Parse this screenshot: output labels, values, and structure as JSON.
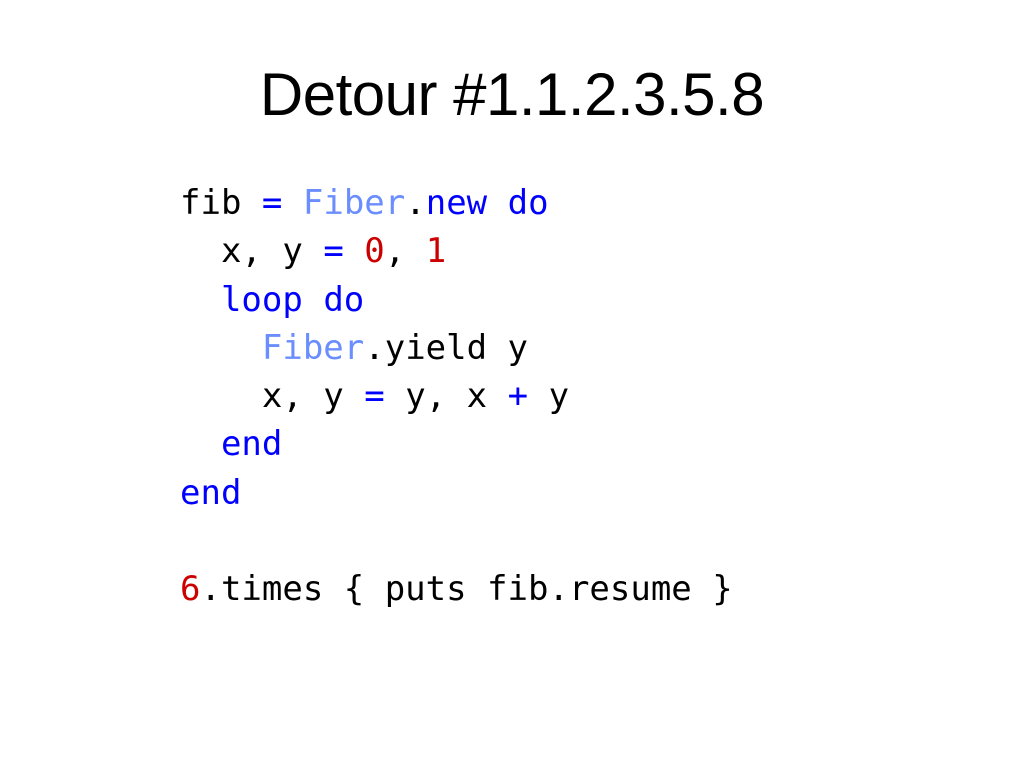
{
  "title": "Detour #1.1.2.3.5.8",
  "code": {
    "line1": {
      "fib": "fib",
      "sp1": " ",
      "eq": "=",
      "sp2": " ",
      "Fiber": "Fiber",
      "dot": ".",
      "new": "new",
      "sp3": " ",
      "do": "do"
    },
    "line2": {
      "indent": "  ",
      "xy": "x, y",
      "sp1": " ",
      "eq": "=",
      "sp2": " ",
      "zero": "0",
      "comma": ",",
      "sp3": " ",
      "one": "1"
    },
    "line3": {
      "indent": "  ",
      "loop": "loop",
      "sp": " ",
      "do": "do"
    },
    "line4": {
      "indent": "    ",
      "Fiber": "Fiber",
      "dot": ".",
      "yield": "yield y"
    },
    "line5": {
      "indent": "    ",
      "xy": "x, y",
      "sp1": " ",
      "eq": "=",
      "sp2": " ",
      "yx": "y, x",
      "sp3": " ",
      "plus": "+",
      "sp4": " ",
      "y": "y"
    },
    "line6": {
      "indent": "  ",
      "end": "end"
    },
    "line7": {
      "end": "end"
    },
    "line8": {
      "empty": ""
    },
    "line9": {
      "six": "6",
      "rest": ".times { puts fib.resume }"
    }
  }
}
